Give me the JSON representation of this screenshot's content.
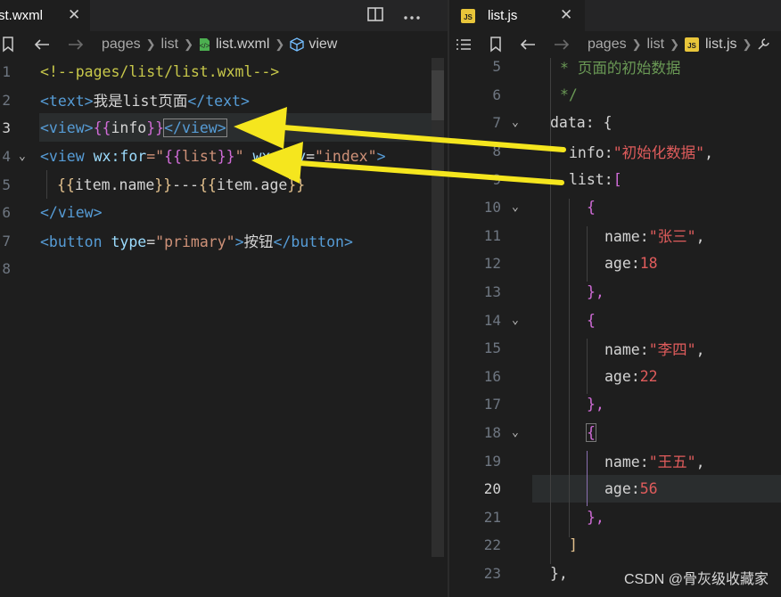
{
  "left": {
    "tab_label": "st.wxml",
    "tab_close": "✕",
    "split_icon": "split-editor-icon",
    "more_icon": "more-actions-icon",
    "breadcrumb": [
      "pages",
      "list",
      "list.wxml",
      "view"
    ],
    "lines": [
      {
        "num": "1"
      },
      {
        "num": "2"
      },
      {
        "num": "3"
      },
      {
        "num": "4"
      },
      {
        "num": "5"
      },
      {
        "num": "6"
      },
      {
        "num": "7"
      },
      {
        "num": "8"
      }
    ],
    "code": {
      "l1": "<!--pages/list/list.wxml-->",
      "l2_open": "<text>",
      "l2_text": "我是list页面",
      "l2_close": "</text>",
      "l3_open": "<view>",
      "l3_b1": "{{",
      "l3_var": "info",
      "l3_b2": "}}",
      "l3_close": "</view>",
      "l4_open": "<view ",
      "l4_attr1": "wx:for",
      "l4_eq1": "=\"",
      "l4_b1": "{{",
      "l4_var": "list",
      "l4_b2": "}}",
      "l4_q1": "\" ",
      "l4_attr2": "wx:key",
      "l4_eq2": "=",
      "l4_val2": "\"index\"",
      "l4_gt": ">",
      "l5_b1": "{{",
      "l5_v1": "item.name",
      "l5_b2": "}}",
      "l5_dash": "---",
      "l5_b3": "{{",
      "l5_v2": "item.age",
      "l5_b4": "}}",
      "l6": "</view>",
      "l7_open": "<button ",
      "l7_attr": "type",
      "l7_eq": "=",
      "l7_val": "\"primary\"",
      "l7_gt": ">",
      "l7_text": "按钮",
      "l7_close": "</button>"
    }
  },
  "right": {
    "tab_label": "list.js",
    "tab_close": "✕",
    "breadcrumb": [
      "pages",
      "list",
      "list.js"
    ],
    "lines": [
      "5",
      "6",
      "7",
      "8",
      "9",
      "10",
      "11",
      "12",
      "13",
      "14",
      "15",
      "16",
      "17",
      "18",
      "19",
      "20",
      "21",
      "22",
      "23"
    ],
    "active_line": "20",
    "code": {
      "l5": "* 页面的初始数据",
      "l6": "*/",
      "l7_key": "data",
      "l7_rest": ": {",
      "l8_key": "info",
      "l8_colon": ":",
      "l8_val": "\"初始化数据\"",
      "l8_comma": ",",
      "l9_key": "list",
      "l9_colon": ":",
      "l9_br": "[",
      "l10": "{",
      "l11_key": "name",
      "l11_colon": ":",
      "l11_val": "\"张三\"",
      "l11_comma": ",",
      "l12_key": "age",
      "l12_colon": ":",
      "l12_val": "18",
      "l13": "},",
      "l14": "{",
      "l15_key": "name",
      "l15_colon": ":",
      "l15_val": "\"李四\"",
      "l15_comma": ",",
      "l16_key": "age",
      "l16_colon": ":",
      "l16_val": "22",
      "l17": "},",
      "l18": "{",
      "l19_key": "name",
      "l19_colon": ":",
      "l19_val": "\"王五\"",
      "l19_comma": ",",
      "l20_key": "age",
      "l20_colon": ":",
      "l20_val": "56",
      "l21": "},",
      "l22": "]",
      "l23": "},"
    }
  },
  "watermark": "CSDN @骨灰级收藏家",
  "colors": {
    "arrow": "#f5e61e",
    "editor_bg": "#1e1e1e",
    "tab_bar_bg": "#252526"
  }
}
